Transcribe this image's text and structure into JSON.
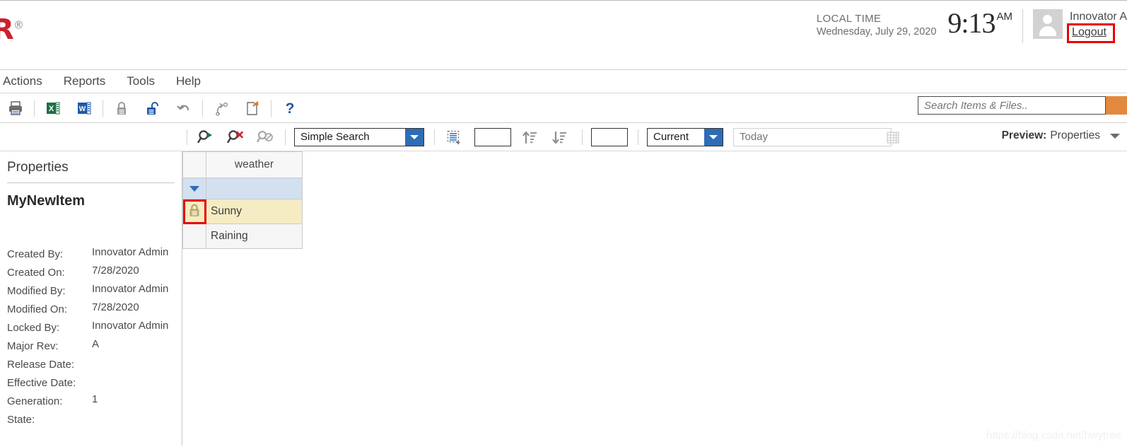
{
  "header": {
    "logo_text": "OR",
    "logo_reg": "®",
    "local_time_label": "LOCAL TIME",
    "local_time_date": "Wednesday, July 29, 2020",
    "clock_time": "9:13",
    "clock_ampm": "AM",
    "user_name": "Innovator A",
    "logout_label": "Logout",
    "avatar_icon": "user-avatar-icon"
  },
  "menu": {
    "items": [
      {
        "label": "Actions",
        "name": "menu-item-actions"
      },
      {
        "label": "Reports",
        "name": "menu-item-reports"
      },
      {
        "label": "Tools",
        "name": "menu-item-tools"
      },
      {
        "label": "Help",
        "name": "menu-item-help"
      }
    ]
  },
  "toolbar": {
    "buttons": [
      {
        "name": "print-icon",
        "title": "Print"
      },
      {
        "name": "export-excel-icon",
        "title": "Export to Excel"
      },
      {
        "name": "export-word-icon",
        "title": "Export to Word"
      },
      {
        "name": "lock-icon",
        "title": "Lock"
      },
      {
        "name": "unlock-icon",
        "title": "Unlock"
      },
      {
        "name": "undo-icon",
        "title": "Undo"
      },
      {
        "name": "redo-icon",
        "title": "Redo"
      },
      {
        "name": "new-version-icon",
        "title": "New Version"
      },
      {
        "name": "help-icon",
        "title": "Help"
      }
    ],
    "help_glyph": "?"
  },
  "search": {
    "placeholder": "Search Items & Files..",
    "value": "",
    "button_color": "#e2893d",
    "button_name": "global-search-button"
  },
  "search_toolbar": {
    "run_search_name": "run-search-icon",
    "clear_search_name": "clear-search-icon",
    "disabled_search_name": "disabled-search-icon",
    "mode_value": "Simple Search",
    "select_all_name": "select-all-rows-icon",
    "page_size_value": "",
    "sort_asc_name": "sort-ascending-icon",
    "sort_desc_name": "sort-descending-icon",
    "page_number_value": "",
    "revision_value": "Current",
    "date_placeholder": "Today",
    "date_value": "",
    "calendar_name": "calendar-icon",
    "preview_label": "Preview:",
    "preview_value": "Properties"
  },
  "properties": {
    "panel_title": "Properties",
    "item_name": "MyNewItem",
    "rows": [
      {
        "label": "Created By:",
        "value": "Innovator Admin"
      },
      {
        "label": "Created On:",
        "value": "7/28/2020"
      },
      {
        "label": "Modified By:",
        "value": "Innovator Admin"
      },
      {
        "label": "Modified On:",
        "value": "7/28/2020"
      },
      {
        "label": "Locked By:",
        "value": "Innovator Admin"
      },
      {
        "label": "Major Rev:",
        "value": "A"
      },
      {
        "label": "Release Date:",
        "value": ""
      },
      {
        "label": "Effective Date:",
        "value": ""
      },
      {
        "label": "Generation:",
        "value": "1"
      },
      {
        "label": "State:",
        "value": ""
      }
    ]
  },
  "grid": {
    "columns": [
      "weather"
    ],
    "filter_row_toggle_name": "filter-row-toggle",
    "rows": [
      {
        "locked": true,
        "selected": true,
        "weather": "Sunny",
        "lock_icon": "locked-padlock-icon"
      },
      {
        "locked": false,
        "selected": false,
        "weather": "Raining",
        "lock_icon": ""
      }
    ]
  },
  "watermark": {
    "text": "https://blog.csdn.net/hwytree"
  },
  "colors": {
    "brand_red": "#cc2031",
    "accent_orange": "#e2893d",
    "combo_blue": "#2e6cb5",
    "row_selected": "#f5ecc4",
    "filter_row": "#d3e0f0",
    "highlight_box": "#e80000"
  }
}
